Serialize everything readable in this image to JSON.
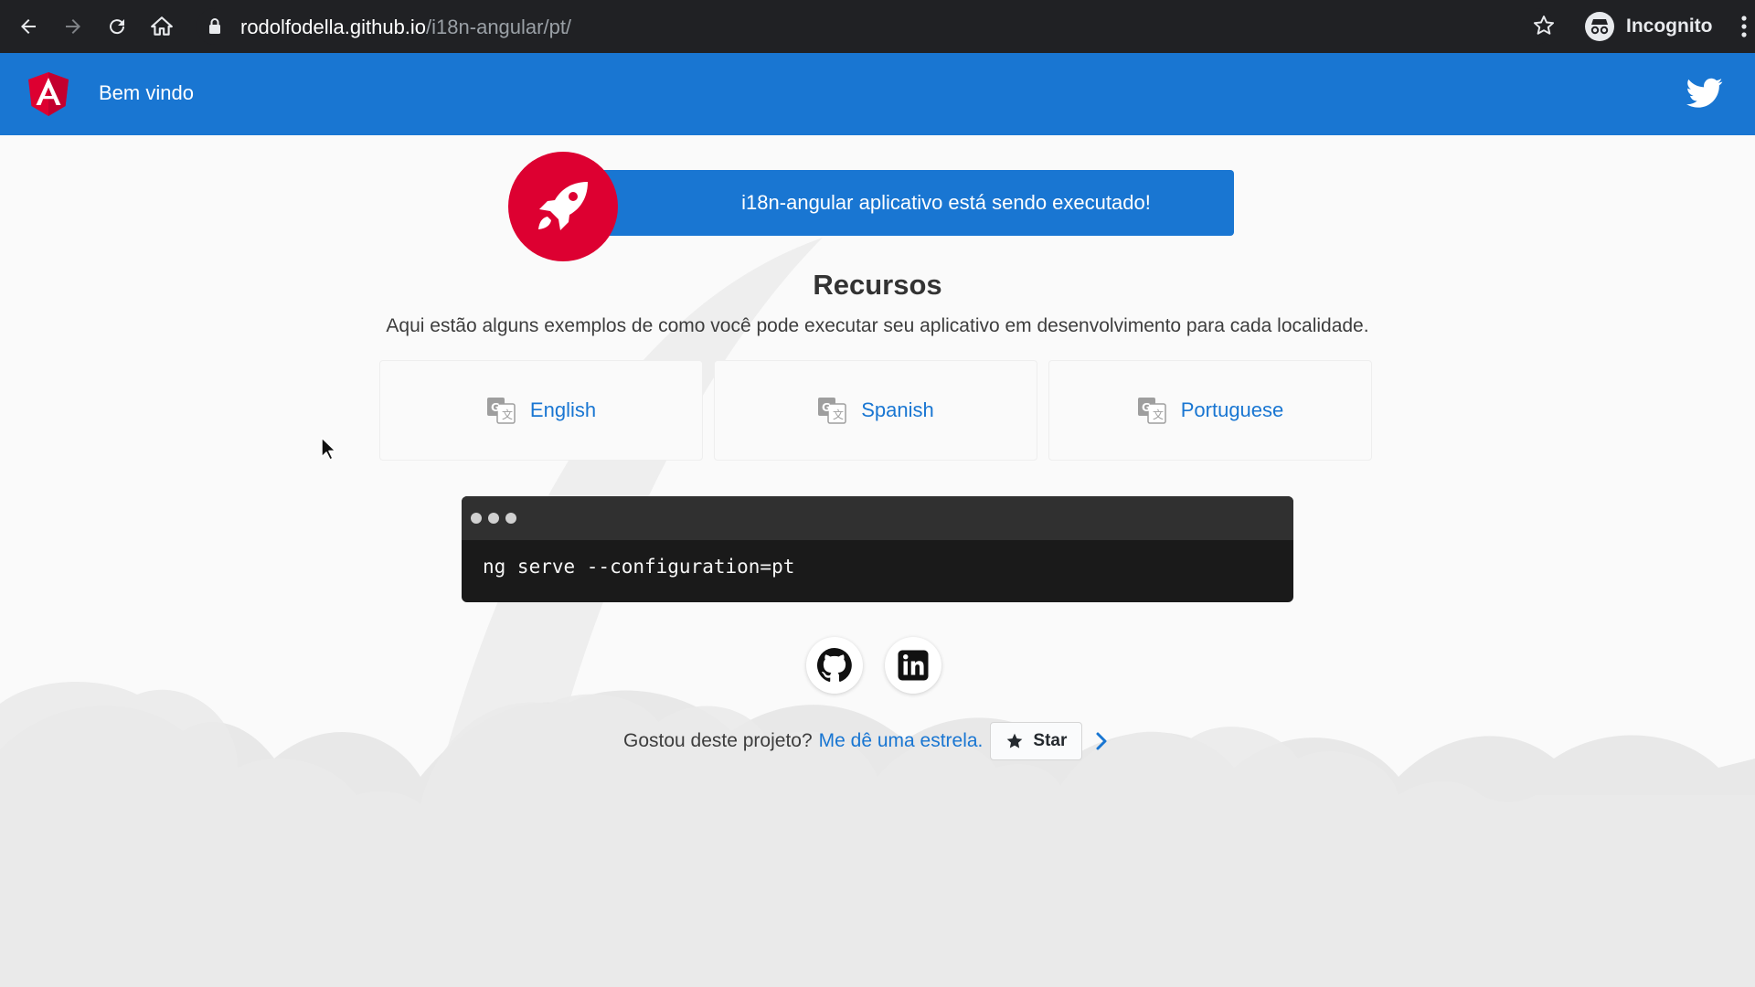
{
  "browser": {
    "url_host": "rodolfodella.github.io",
    "url_path": "/i18n-angular/pt/",
    "profile_label": "Incognito"
  },
  "toolbar": {
    "title": "Bem vindo",
    "brand_color": "#1976d2"
  },
  "banner": {
    "text": "i18n-angular aplicativo está sendo executado!",
    "accent_color": "#dd0031"
  },
  "resources": {
    "heading": "Recursos",
    "subtitle": "Aqui estão alguns exemplos de como você pode executar seu aplicativo em desenvolvimento para cada localidade.",
    "cards": [
      {
        "label": "English",
        "icon": "translate-icon"
      },
      {
        "label": "Spanish",
        "icon": "translate-icon"
      },
      {
        "label": "Portuguese",
        "icon": "translate-icon"
      }
    ]
  },
  "terminal": {
    "command": "ng serve --configuration=pt"
  },
  "social": {
    "items": [
      {
        "icon": "github-icon"
      },
      {
        "icon": "linkedin-icon"
      }
    ]
  },
  "footer": {
    "question": "Gostou deste projeto?",
    "link_text": "Me dê uma estrela.",
    "star_label": "Star"
  }
}
